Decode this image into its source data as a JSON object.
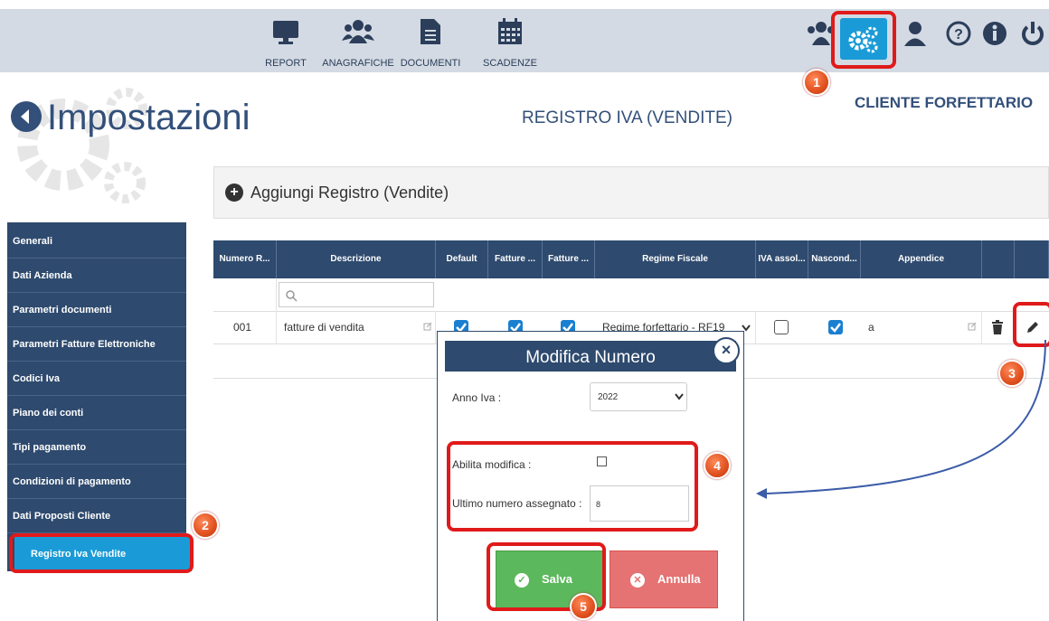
{
  "topnav": {
    "items": [
      {
        "label": "REPORT",
        "icon": "monitor-icon"
      },
      {
        "label": "ANAGRAFICHE",
        "icon": "users-icon"
      },
      {
        "label": "DOCUMENTI",
        "icon": "document-icon"
      },
      {
        "label": "SCADENZE",
        "icon": "calendar-icon"
      }
    ],
    "right_icons": [
      "users-icon",
      "gears-icon",
      "user-icon",
      "help-icon",
      "info-icon",
      "power-icon"
    ]
  },
  "header": {
    "title": "Impostazioni",
    "section": "REGISTRO IVA (VENDITE)",
    "client": "CLIENTE FORFETTARIO"
  },
  "add_button": {
    "label": "Aggiungi Registro (Vendite)"
  },
  "sidebar": {
    "items": [
      {
        "label": "Generali"
      },
      {
        "label": "Dati Azienda"
      },
      {
        "label": "Parametri documenti"
      },
      {
        "label": "Parametri Fatture Elettroniche"
      },
      {
        "label": "Codici Iva"
      },
      {
        "label": "Piano dei conti"
      },
      {
        "label": "Tipi pagamento"
      },
      {
        "label": "Condizioni di pagamento"
      },
      {
        "label": "Dati Proposti Cliente"
      },
      {
        "label": "Registro Iva Vendite"
      }
    ],
    "active": "Registro Iva Vendite"
  },
  "table": {
    "columns": [
      "Numero R...",
      "Descrizione",
      "Default",
      "Fatture ...",
      "Fatture ...",
      "Regime Fiscale",
      "IVA assol...",
      "Nascond...",
      "Appendice",
      "",
      ""
    ],
    "rows": [
      {
        "numero": "001",
        "descrizione": "fatture di vendita",
        "default": true,
        "fatture1": true,
        "fatture2": true,
        "regime": "Regime forfettario - RF19",
        "iva_assolta": false,
        "nascondi": true,
        "appendice": "a"
      }
    ]
  },
  "dialog": {
    "title": "Modifica Numero",
    "anno_label": "Anno Iva :",
    "anno_value": "2022",
    "abilita_label": "Abilita modifica :",
    "abilita_checked": false,
    "ultimo_label": "Ultimo numero assegnato :",
    "ultimo_value": "8",
    "save_label": "Salva",
    "cancel_label": "Annulla"
  },
  "steps": [
    "1",
    "2",
    "3",
    "4",
    "5"
  ],
  "colors": {
    "navy": "#2e4a6e",
    "accent": "#1a9bd7",
    "annotation_red": "#e01a1a",
    "step_orange": "#e0501e",
    "save_green": "#5cb85c",
    "cancel_red": "#e57373"
  }
}
